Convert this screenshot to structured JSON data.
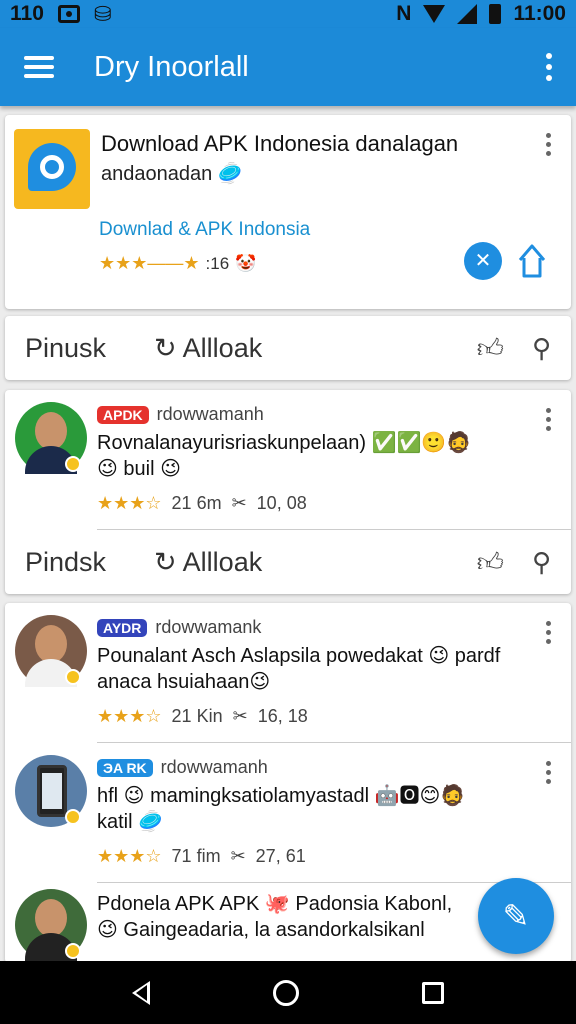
{
  "status_bar": {
    "left_text": "110",
    "time": "11:00"
  },
  "app_bar": {
    "title": "Dry Inoorlall"
  },
  "featured": {
    "title": "Download APK Indonesia danalagan",
    "subtitle": "andaonadan",
    "subtitle_emoji": "🥏",
    "link": "Downlad & APK Indonsia",
    "stars": "★★★——★",
    "rating_text": ":16",
    "rating_emoji": "🤡"
  },
  "action_rows": [
    {
      "first_label": "Pinusk",
      "second_label": "Allloak"
    },
    {
      "first_label": "Pindsk",
      "second_label": "Allloak"
    }
  ],
  "posts": [
    {
      "tag": "APDK",
      "tag_color": "#e5322d",
      "user": "rdowwamanh",
      "text": "Rovnalanayurisriaskunpelaan) ✅✅🙂🧔 😉 buil 😉",
      "stars": "★★★☆",
      "count": "21 6m",
      "share_icon": "✂",
      "score": "10, 08"
    },
    {
      "tag": "AYDR",
      "tag_color": "#3344bb",
      "user": "rdowwamank",
      "text": "Pounalant Asch Aslapsila powedakat 😉 pardf anaca hsuiahaan😉",
      "stars": "★★★☆",
      "count": "21 Kin",
      "share_icon": "✂",
      "score": "16, 18"
    },
    {
      "tag": "ЭA RK",
      "tag_color": "#1f8ee0",
      "user": "rdowwamanh",
      "text": "hfl 😉 mamingksatiolamyastadl 🤖🅾😊🧔 katil 🥏",
      "stars": "★★★☆",
      "count": "71 fim",
      "share_icon": "✂",
      "score": "27, 61"
    },
    {
      "text": "Pdonela APK APK 🐙 Padonsia Kabonl, 😉 Gaingeadaria, la asandorkalsikanl"
    }
  ]
}
